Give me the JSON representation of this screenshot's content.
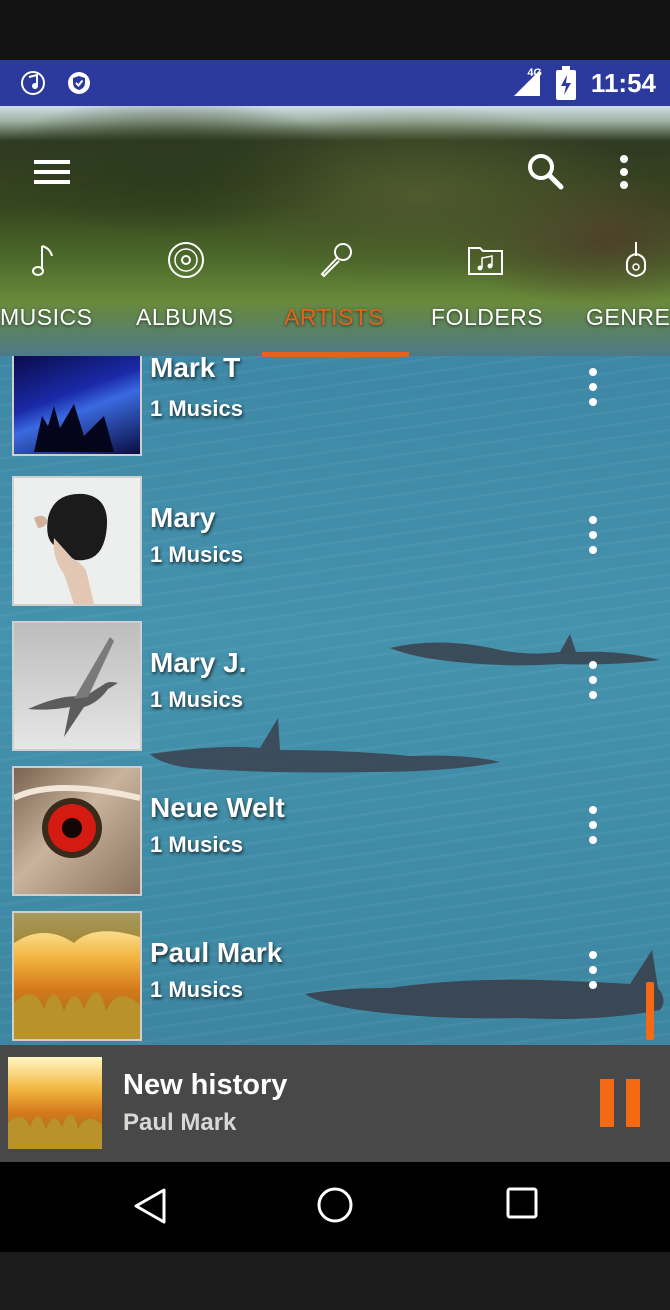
{
  "status_bar": {
    "time": "11:54",
    "network": "4G",
    "left_icons": [
      "music-app-notification-icon",
      "vpn-shield-icon"
    ],
    "right_icons": [
      "signal-icon",
      "battery-charging-icon"
    ]
  },
  "toolbar": {
    "menu_icon": "hamburger-menu-icon",
    "search_icon": "search-icon",
    "overflow_icon": "more-vert-icon"
  },
  "tabs": [
    {
      "label": "MUSICS",
      "icon": "music-note-icon",
      "active": false
    },
    {
      "label": "ALBUMS",
      "icon": "disc-icon",
      "active": false
    },
    {
      "label": "ARTISTS",
      "icon": "microphone-icon",
      "active": true
    },
    {
      "label": "FOLDERS",
      "icon": "music-folder-icon",
      "active": false
    },
    {
      "label": "GENRES",
      "icon": "guitar-icon",
      "active": false
    }
  ],
  "artists": [
    {
      "name": "Mark T",
      "count": "1 Musics"
    },
    {
      "name": "Mary",
      "count": "1 Musics"
    },
    {
      "name": "Mary J.",
      "count": "1 Musics"
    },
    {
      "name": "Neue Welt",
      "count": "1 Musics"
    },
    {
      "name": "Paul Mark",
      "count": "1 Musics"
    }
  ],
  "now_playing": {
    "title": "New history",
    "artist": "Paul Mark",
    "state": "playing"
  },
  "nav_bar": [
    "back-icon",
    "home-icon",
    "recents-icon"
  ],
  "colors": {
    "accent": "#e4621b",
    "status_bar": "#2b3a9c",
    "now_playing_bg": "#484848",
    "pause": "#f46a14"
  }
}
